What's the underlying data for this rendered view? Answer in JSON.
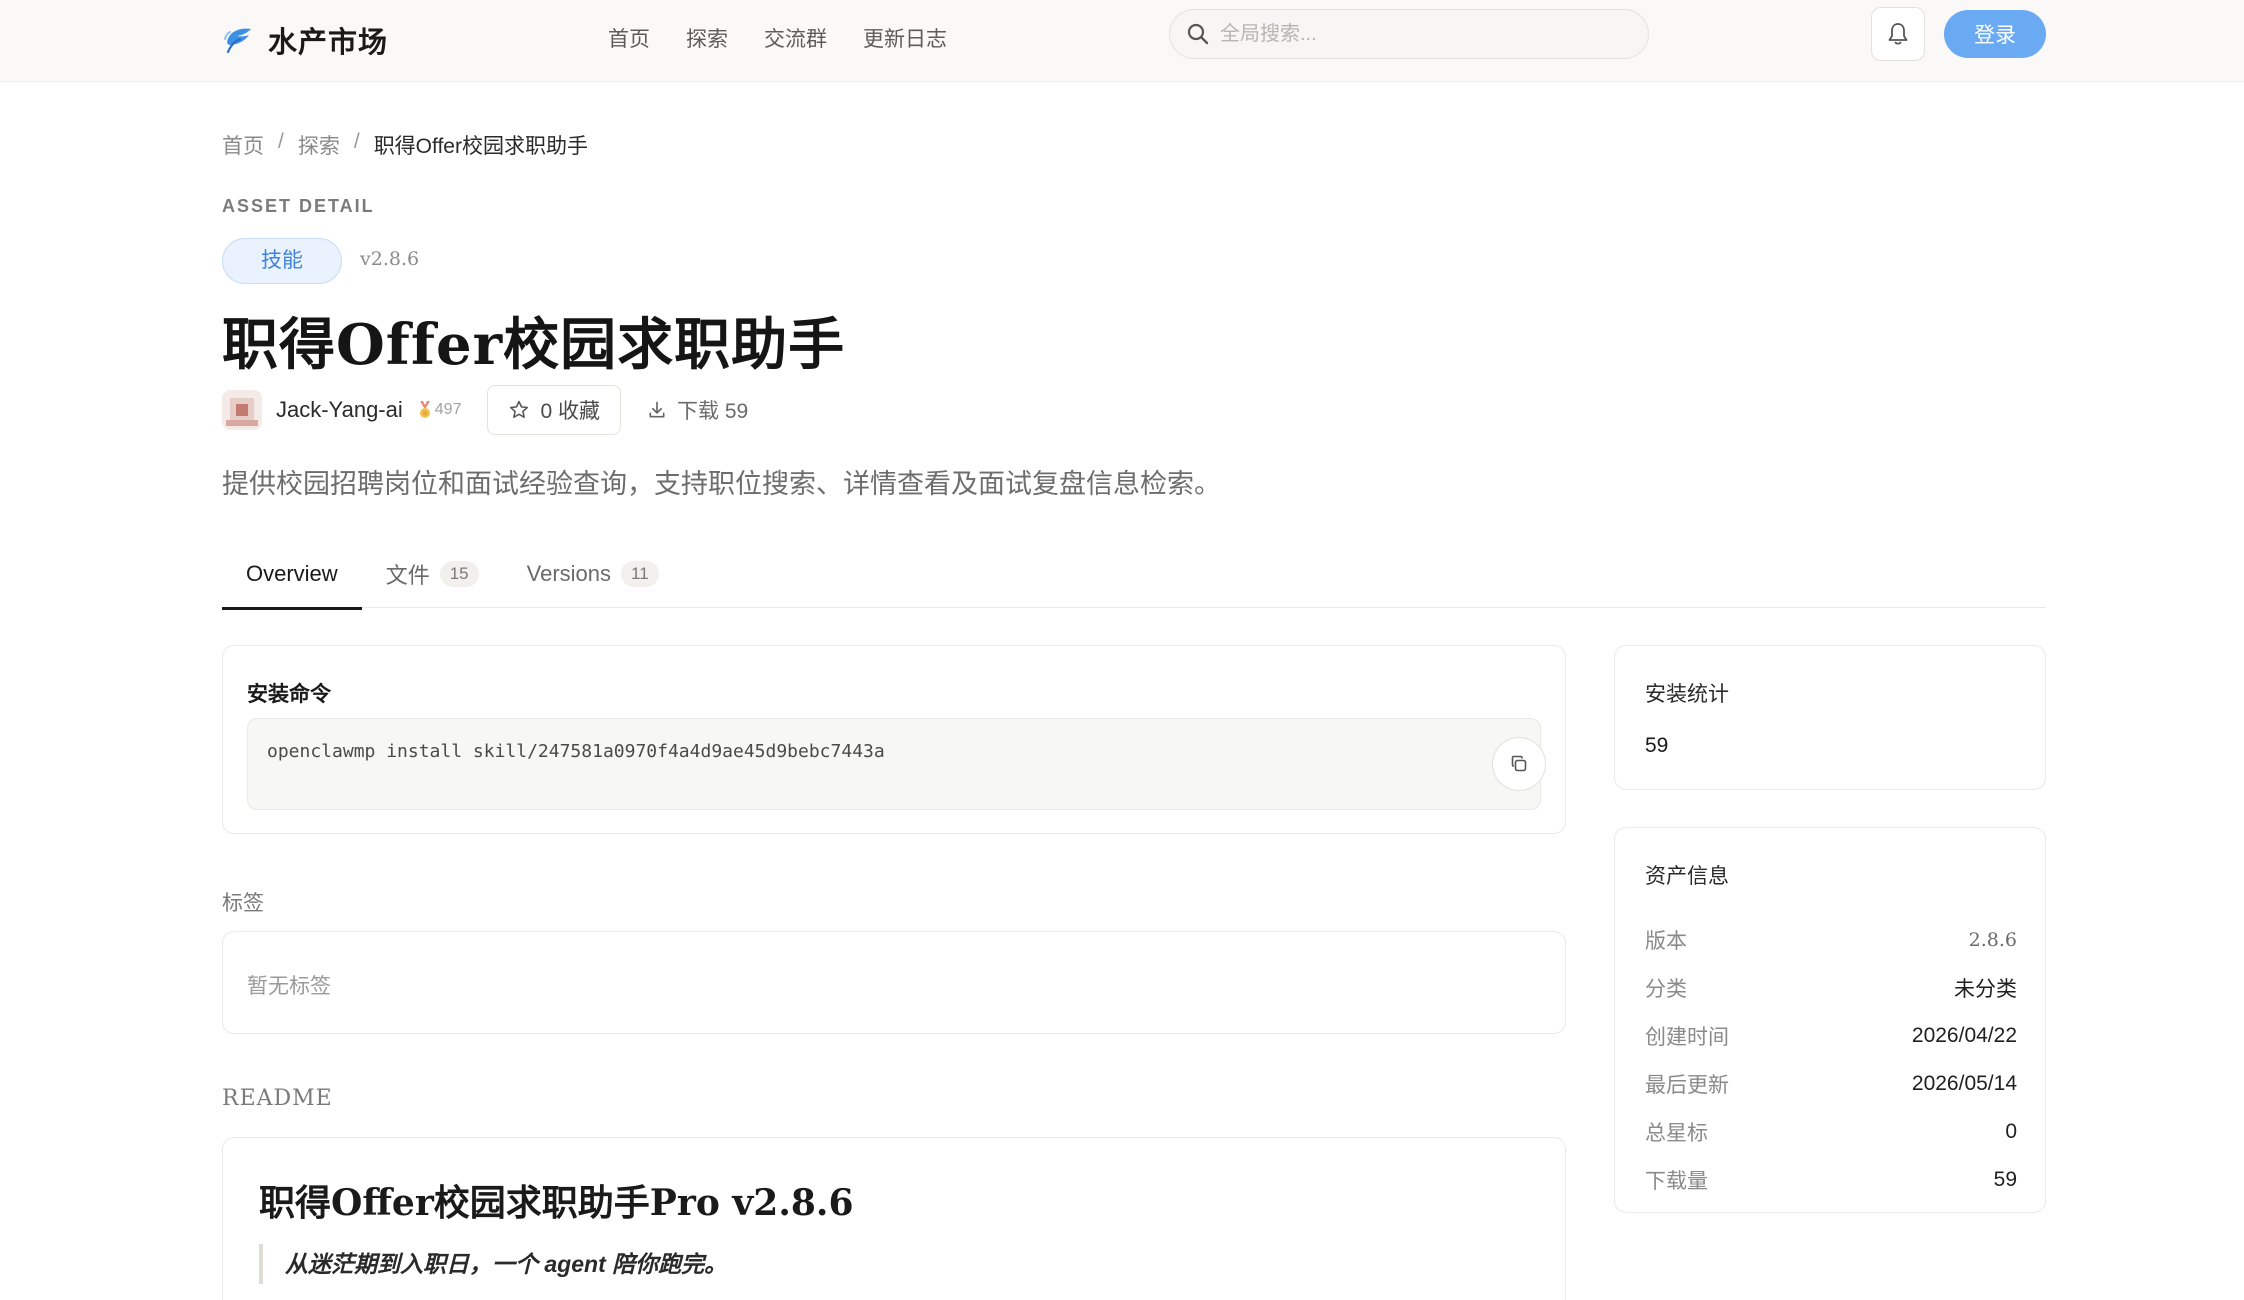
{
  "colors": {
    "accent": "#6aaaf2",
    "chip_bg": "#e9f2fd",
    "chip_text": "#3f84d9",
    "topbar_bg": "#faf9f7"
  },
  "header": {
    "brand_icon": "leaf-logo-icon",
    "brand_name": "水产市场",
    "nav": [
      {
        "label": "首页"
      },
      {
        "label": "探索"
      },
      {
        "label": "交流群"
      },
      {
        "label": "更新日志"
      }
    ],
    "search_placeholder": "全局搜索...",
    "search_icon": "search-icon",
    "bell_icon": "bell-icon",
    "login_label": "登录"
  },
  "breadcrumb": {
    "items": [
      {
        "label": "首页"
      },
      {
        "label": "探索"
      }
    ],
    "separator": "/",
    "current": "职得Offer校园求职助手"
  },
  "asset": {
    "eyebrow": "ASSET DETAIL",
    "type_chip": "技能",
    "version_tag": "v2.8.6",
    "title": "职得Offer校园求职助手",
    "author": "Jack-Yang-ai",
    "author_medal_icon": "medal-icon",
    "author_points": "497",
    "favorite_label": "0 收藏",
    "favorite_icon": "star-icon",
    "downloads_label": "下载 59",
    "downloads_icon": "download-icon",
    "description": "提供校园招聘岗位和面试经验查询，支持职位搜索、详情查看及面试复盘信息检索。"
  },
  "tabs": [
    {
      "label": "Overview",
      "count": null,
      "active": true
    },
    {
      "label": "文件",
      "count": "15",
      "active": false
    },
    {
      "label": "Versions",
      "count": "11",
      "active": false
    }
  ],
  "install": {
    "title": "安装命令",
    "command": "openclawmp install skill/247581a0970f4a4d9ae45d9bebc7443a",
    "copy_icon": "copy-icon"
  },
  "tags": {
    "label": "标签",
    "empty_text": "暂无标签"
  },
  "readme": {
    "label": "README",
    "heading": "职得Offer校园求职助手Pro v2.8.6",
    "quote": "从迷茫期到入职日，一个 agent 陪你跑完。"
  },
  "install_stats": {
    "title": "安装统计",
    "value": "59"
  },
  "asset_info": {
    "title": "资产信息",
    "rows": [
      {
        "key": "版本",
        "value": "2.8.6"
      },
      {
        "key": "分类",
        "value": "未分类"
      },
      {
        "key": "创建时间",
        "value": "2026/04/22"
      },
      {
        "key": "最后更新",
        "value": "2026/05/14"
      },
      {
        "key": "总星标",
        "value": "0"
      },
      {
        "key": "下载量",
        "value": "59"
      }
    ]
  }
}
